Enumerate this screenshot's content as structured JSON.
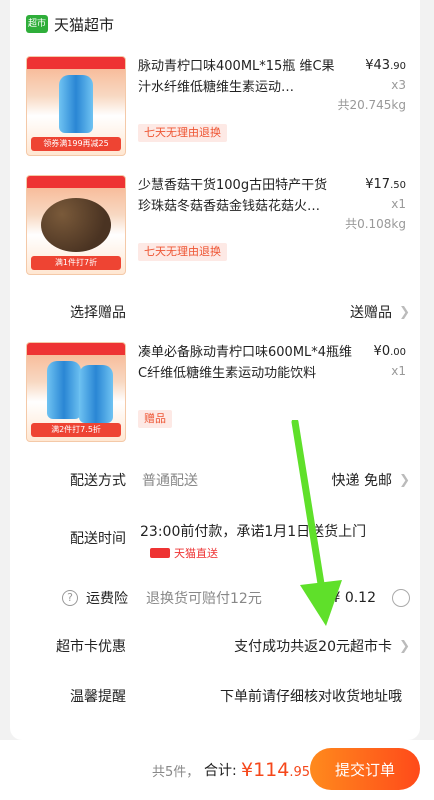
{
  "store": {
    "logo_text": "超市",
    "name": "天猫超市"
  },
  "products": [
    {
      "title": "脉动青柠口味400ML*15瓶 维C果汁水纤维低糖维生素运动…",
      "price_int": "¥43",
      "price_dec": ".90",
      "qty": "x3",
      "weight": "共20.745kg",
      "badge": "七天无理由退换",
      "thumb_tag": "领券满199再减25"
    },
    {
      "title": "少慧香菇干货100g古田特产干货珍珠菇冬菇香菇金钱菇花菇火…",
      "price_int": "¥17",
      "price_dec": ".50",
      "qty": "x1",
      "weight": "共0.108kg",
      "badge": "七天无理由退换",
      "thumb_tag": "满1件打7折"
    },
    {
      "title": "凑单必备脉动青柠口味600ML*4瓶维C纤维低糖维生素运动功能饮料",
      "price_int": "¥0",
      "price_dec": ".00",
      "qty": "x1",
      "badge": "赠品",
      "thumb_tag": "满2件打7.5折"
    }
  ],
  "gift_row": {
    "label": "选择赠品",
    "value": "送赠品"
  },
  "delivery": {
    "label": "配送方式",
    "value": "普通配送",
    "right": "快递 免邮"
  },
  "time": {
    "label": "配送时间",
    "value": "23:00前付款，承诺1月1日送货上门",
    "tmall": "天猫直送"
  },
  "insurance": {
    "label": "运费险",
    "value": "退换货可赔付12元",
    "price": "¥ 0.12"
  },
  "card_discount": {
    "label": "超市卡优惠",
    "value": "支付成功共返20元超市卡"
  },
  "reminder": {
    "label": "温馨提醒",
    "value": "下单前请仔细核对收货地址哦"
  },
  "footer": {
    "count": "共5件，",
    "total_label": "合计:",
    "total_int": "¥114",
    "total_dec": ".95",
    "submit": "提交订单"
  },
  "colors": {
    "accent": "#f5471a",
    "brand_green": "#2fae3a"
  }
}
